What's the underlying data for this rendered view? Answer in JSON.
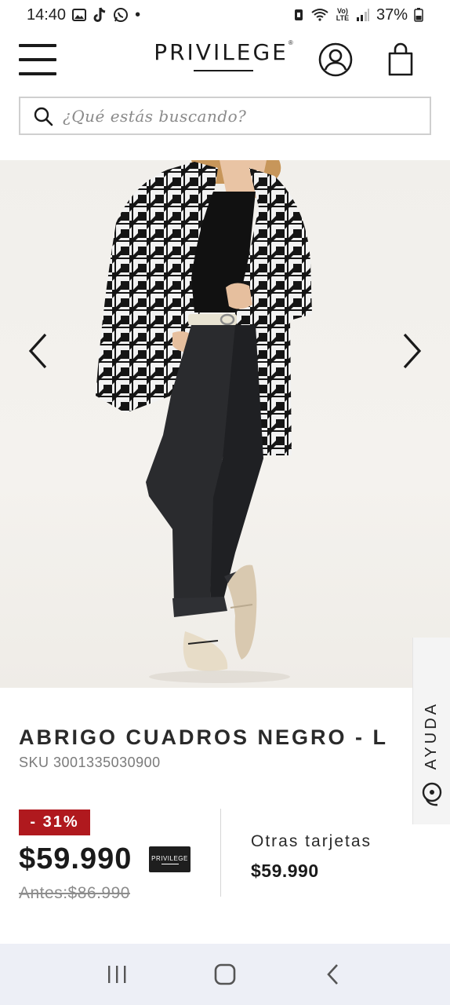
{
  "status_bar": {
    "time": "14:40",
    "dot": "•",
    "battery": "37%",
    "network": "Vo) LTE"
  },
  "header": {
    "brand": "PRIVILEGE",
    "brand_mark": "®"
  },
  "search": {
    "placeholder": "¿Qué estás buscando?"
  },
  "product": {
    "title": "ABRIGO CUADROS NEGRO - L",
    "sku": "SKU 3001335030900",
    "discount": "- 31%",
    "price": "$59.990",
    "price_before": "Antes:$86.990",
    "card_badge": "PRIVILEGE",
    "other_cards_label": "Otras tarjetas",
    "other_cards_price": "$59.990"
  },
  "help": {
    "label": "AYUDA"
  },
  "colors": {
    "discount_bg": "#b0191e",
    "nav_bg": "#edeff6"
  }
}
